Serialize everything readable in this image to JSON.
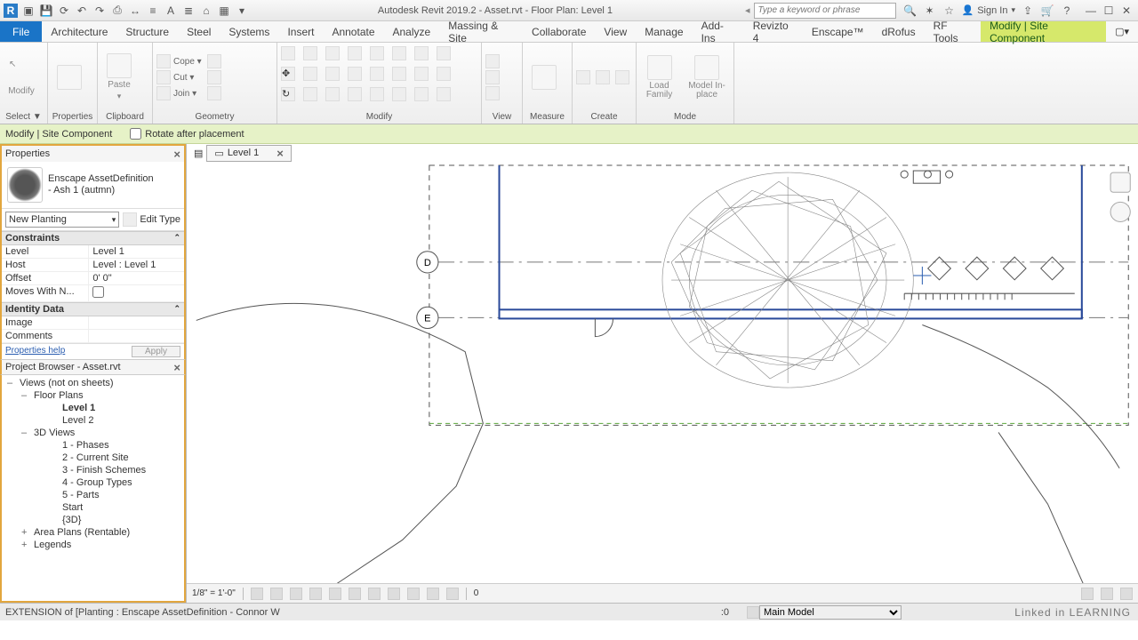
{
  "title_bar": {
    "doc_title": "Autodesk Revit 2019.2 - Asset.rvt - Floor Plan: Level 1",
    "search_placeholder": "Type a keyword or phrase",
    "signin": "Sign In"
  },
  "ribbon": {
    "file": "File",
    "tabs": [
      "Architecture",
      "Structure",
      "Steel",
      "Systems",
      "Insert",
      "Annotate",
      "Analyze",
      "Massing & Site",
      "Collaborate",
      "View",
      "Manage",
      "Add-Ins",
      "Revizto 4",
      "Enscape™",
      "dRofus",
      "RF Tools",
      "Modify | Site Component"
    ],
    "active_index": 16,
    "panels": {
      "select": {
        "label": "Select ▼",
        "btn": ""
      },
      "properties": {
        "label": "Properties",
        "btn": ""
      },
      "clipboard": {
        "label": "Clipboard",
        "paste": "Paste"
      },
      "geometry": {
        "label": "Geometry",
        "cope": "Cope ▾",
        "cut": "Cut ▾",
        "join": "Join ▾"
      },
      "modify": {
        "label": "Modify"
      },
      "view": {
        "label": "View"
      },
      "measure": {
        "label": "Measure"
      },
      "create": {
        "label": "Create"
      },
      "mode": {
        "label": "Mode",
        "load_family": "Load Family",
        "model_inplace": "Model In-place"
      },
      "modify_btn": "Modify"
    }
  },
  "options_bar": {
    "context": "Modify | Site Component",
    "rotate": "Rotate after placement"
  },
  "properties": {
    "title": "Properties",
    "type_family": "Enscape AssetDefinition",
    "type_name": "- Ash 1 (autmn)",
    "combo": "New Planting",
    "edit_type": "Edit Type",
    "sections": {
      "constraints": "Constraints",
      "identity": "Identity Data"
    },
    "rows": {
      "level_k": "Level",
      "level_v": "Level 1",
      "host_k": "Host",
      "host_v": "Level : Level 1",
      "offset_k": "Offset",
      "offset_v": "0'  0\"",
      "moves_k": "Moves With N...",
      "moves_v": "",
      "image_k": "Image",
      "image_v": "",
      "comments_k": "Comments",
      "comments_v": ""
    },
    "help": "Properties help",
    "apply": "Apply"
  },
  "project_browser": {
    "title": "Project Browser - Asset.rvt",
    "nodes": [
      {
        "lvl": 1,
        "exp": "–",
        "label": "Views (not on sheets)"
      },
      {
        "lvl": 2,
        "exp": "–",
        "label": "Floor Plans"
      },
      {
        "lvl": 4,
        "exp": "",
        "label": "Level 1",
        "bold": true
      },
      {
        "lvl": 4,
        "exp": "",
        "label": "Level 2"
      },
      {
        "lvl": 2,
        "exp": "–",
        "label": "3D Views"
      },
      {
        "lvl": 4,
        "exp": "",
        "label": "1 - Phases"
      },
      {
        "lvl": 4,
        "exp": "",
        "label": "2 - Current Site"
      },
      {
        "lvl": 4,
        "exp": "",
        "label": "3 - Finish Schemes"
      },
      {
        "lvl": 4,
        "exp": "",
        "label": "4 - Group Types"
      },
      {
        "lvl": 4,
        "exp": "",
        "label": "5 - Parts"
      },
      {
        "lvl": 4,
        "exp": "",
        "label": "Start"
      },
      {
        "lvl": 4,
        "exp": "",
        "label": "{3D}"
      },
      {
        "lvl": 2,
        "exp": "+",
        "label": "Area Plans (Rentable)"
      },
      {
        "lvl": 2,
        "exp": "+",
        "label": "Legends"
      }
    ]
  },
  "view_tab": {
    "label": "Level 1"
  },
  "grid_bubbles": {
    "d": "D",
    "e": "E"
  },
  "view_ctrl": {
    "scale": "1/8\" = 1'-0\"",
    "zero": "0"
  },
  "status": {
    "left": "EXTENSION  of [Planting : Enscape AssetDefinition - Connor W",
    "sel": ":0",
    "main_model": "Main Model"
  },
  "learning": "Linked in LEARNING"
}
